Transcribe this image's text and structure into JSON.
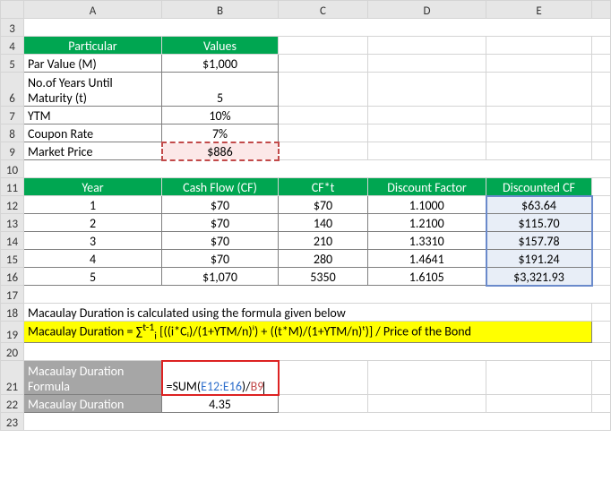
{
  "columns": [
    "A",
    "B",
    "C",
    "D",
    "E"
  ],
  "row_labels": [
    "3",
    "4",
    "5",
    "6",
    "7",
    "8",
    "9",
    "10",
    "11",
    "12",
    "13",
    "14",
    "15",
    "16",
    "17",
    "18",
    "19",
    "20",
    "21",
    "22",
    "23"
  ],
  "params_header": {
    "particular": "Particular",
    "values": "Values"
  },
  "params": [
    {
      "label": "Par Value (M)",
      "value": "$1,000"
    },
    {
      "label": "No.of Years Until Maturity (t)",
      "value": "5"
    },
    {
      "label": "YTM",
      "value": "10%"
    },
    {
      "label": "Coupon Rate",
      "value": "7%"
    },
    {
      "label": "Market Price",
      "value": "$886"
    }
  ],
  "table_header": {
    "year": "Year",
    "cf": "Cash Flow (CF)",
    "cft": "CF*t",
    "df": "Discount Factor",
    "dcf": "Discounted CF"
  },
  "rows": [
    {
      "year": "1",
      "cf": "$70",
      "cft": "$70",
      "df": "1.1000",
      "dcf": "$63.64"
    },
    {
      "year": "2",
      "cf": "$70",
      "cft": "140",
      "df": "1.2100",
      "dcf": "$115.70"
    },
    {
      "year": "3",
      "cf": "$70",
      "cft": "210",
      "df": "1.3310",
      "dcf": "$157.78"
    },
    {
      "year": "4",
      "cf": "$70",
      "cft": "280",
      "df": "1.4641",
      "dcf": "$191.24"
    },
    {
      "year": "5",
      "cf": "$1,070",
      "cft": "5350",
      "df": "1.6105",
      "dcf": "$3,321.93"
    }
  ],
  "note": "Macaulay Duration is calculated using the formula given below",
  "formula_text_prefix": "Macaulay Duration = ∑",
  "formula_text_sup": "t-1",
  "formula_text_sub": "i",
  "formula_text_rest": " [((i*Cᵢ)/(1+YTM/n)ⁱ) + ((t*M)/(1+YTM/n)ᵗ)] / Price of the Bond",
  "result_labels": {
    "formula": "Macaulay Duration Formula",
    "value": "Macaulay Duration"
  },
  "cell_formula": {
    "prefix": "=SUM(",
    "range": "E12:E16",
    "mid": ")/",
    "ref": "B9"
  },
  "result_value": "4.35",
  "chart_data": {
    "type": "table",
    "title": "Macaulay Duration Calculation",
    "inputs": {
      "par_value": 1000,
      "years_to_maturity": 5,
      "ytm": 0.1,
      "coupon_rate": 0.07,
      "market_price": 886
    },
    "cashflows": [
      {
        "year": 1,
        "cash_flow": 70,
        "cf_times_t": 70,
        "discount_factor": 1.1,
        "discounted_cf": 63.64
      },
      {
        "year": 2,
        "cash_flow": 70,
        "cf_times_t": 140,
        "discount_factor": 1.21,
        "discounted_cf": 115.7
      },
      {
        "year": 3,
        "cash_flow": 70,
        "cf_times_t": 210,
        "discount_factor": 1.331,
        "discounted_cf": 157.78
      },
      {
        "year": 4,
        "cash_flow": 70,
        "cf_times_t": 280,
        "discount_factor": 1.4641,
        "discounted_cf": 191.24
      },
      {
        "year": 5,
        "cash_flow": 1070,
        "cf_times_t": 5350,
        "discount_factor": 1.6105,
        "discounted_cf": 3321.93
      }
    ],
    "macaulay_duration": 4.35,
    "formula": "Macaulay Duration = SUM(Discounted CF) / Market Price"
  }
}
